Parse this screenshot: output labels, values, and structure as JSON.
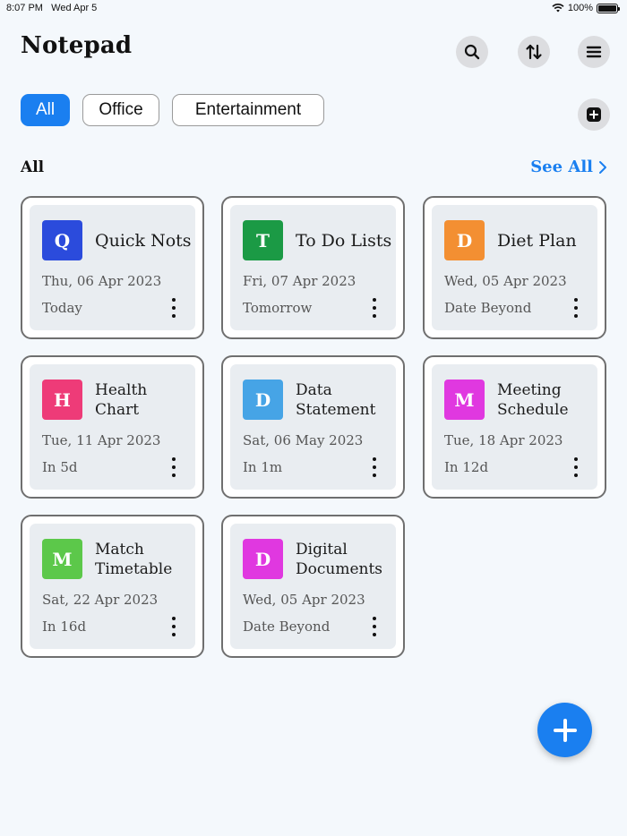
{
  "status_bar": {
    "time": "8:07 PM",
    "date": "Wed Apr 5",
    "battery": "100%"
  },
  "header": {
    "title": "Notepad"
  },
  "icons": {
    "search": "search-icon",
    "sort": "sort-icon",
    "menu": "menu-icon",
    "add_category": "plus-square-icon",
    "fab": "plus-icon"
  },
  "categories": [
    {
      "label": "All",
      "active": true
    },
    {
      "label": "Office",
      "active": false
    },
    {
      "label": "Entertainment",
      "active": false
    }
  ],
  "section": {
    "title": "All",
    "see_all": "See All"
  },
  "notes": [
    {
      "letter": "Q",
      "title": "Quick Nots",
      "date": "Thu, 06 Apr 2023",
      "relative": "Today",
      "color": "#2b4bdc"
    },
    {
      "letter": "T",
      "title": "To Do Lists",
      "date": "Fri, 07 Apr 2023",
      "relative": "Tomorrow",
      "color": "#1b9a45"
    },
    {
      "letter": "D",
      "title": "Diet Plan",
      "date": "Wed, 05 Apr 2023",
      "relative": "Date Beyond",
      "color": "#f38f32"
    },
    {
      "letter": "H",
      "title": "Health Chart",
      "date": "Tue, 11 Apr 2023",
      "relative": "In 5d",
      "color": "#ee3b78"
    },
    {
      "letter": "D",
      "title": "Data Statement",
      "date": "Sat, 06 May 2023",
      "relative": "In 1m",
      "color": "#46a4e6"
    },
    {
      "letter": "M",
      "title": "Meeting Schedule",
      "date": "Tue, 18 Apr 2023",
      "relative": "In 12d",
      "color": "#e038e0"
    },
    {
      "letter": "M",
      "title": "Match Timetable",
      "date": "Sat, 22 Apr 2023",
      "relative": "In 16d",
      "color": "#5cc84a"
    },
    {
      "letter": "D",
      "title": "Digital Documents",
      "date": "Wed, 05 Apr 2023",
      "relative": "Date Beyond",
      "color": "#e038e0"
    }
  ]
}
